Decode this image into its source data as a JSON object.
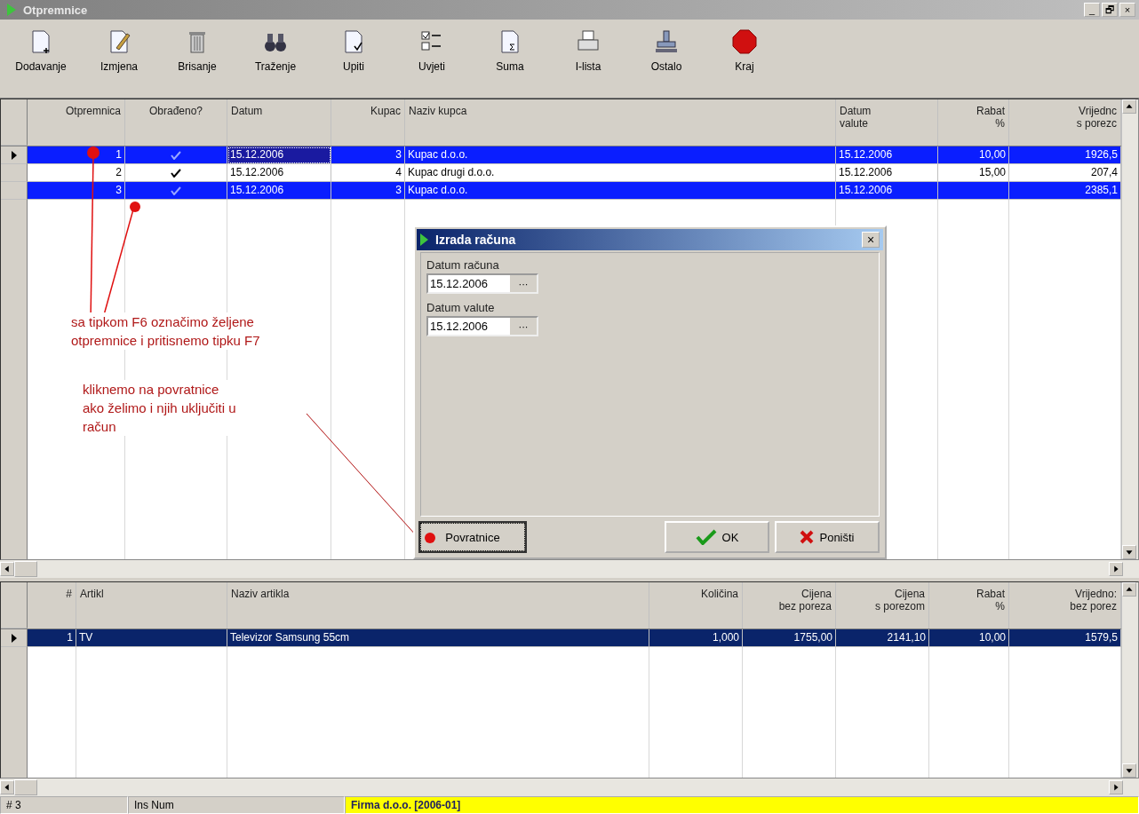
{
  "window": {
    "title": "Otpremnice",
    "controls": [
      "_",
      "🗗",
      "×"
    ]
  },
  "toolbar": [
    {
      "label": "Dodavanje",
      "kind": "new"
    },
    {
      "label": "Izmjena",
      "kind": "edit"
    },
    {
      "label": "Brisanje",
      "kind": "delete"
    },
    {
      "label": "Traženje",
      "kind": "find"
    },
    {
      "label": "Upiti",
      "kind": "query"
    },
    {
      "label": "Uvjeti",
      "kind": "conditions"
    },
    {
      "label": "Suma",
      "kind": "sum"
    },
    {
      "label": "I-lista",
      "kind": "print"
    },
    {
      "label": "Ostalo",
      "kind": "other"
    },
    {
      "label": "Kraj",
      "kind": "stop"
    }
  ],
  "upper_table": {
    "columns": [
      "Otpremnica",
      "Obrađeno?",
      "Datum",
      "Kupac",
      "Naziv kupca",
      "Datum\nvalute",
      "Rabat\n%",
      "Vrijednc\ns porezc"
    ],
    "rows": [
      {
        "selected": true,
        "current": true,
        "cells": [
          "1",
          "",
          "15.12.2006",
          "3",
          "Kupac d.o.o.",
          "15.12.2006",
          "10,00",
          "1926,5"
        ],
        "checked": true
      },
      {
        "selected": false,
        "current": false,
        "cells": [
          "2",
          "",
          "15.12.2006",
          "4",
          "Kupac drugi d.o.o.",
          "15.12.2006",
          "15,00",
          "207,4"
        ],
        "checked": true
      },
      {
        "selected": true,
        "current": false,
        "cells": [
          "3",
          "",
          "15.12.2006",
          "3",
          "Kupac d.o.o.",
          "15.12.2006",
          "",
          "2385,1"
        ],
        "checked": true
      }
    ]
  },
  "lower_table": {
    "columns": [
      "#",
      "Artikl",
      "Naziv artikla",
      "Količina",
      "Cijena\nbez poreza",
      "Cijena\ns porezom",
      "Rabat\n%",
      "Vrijedno:\nbez porez"
    ],
    "rows": [
      {
        "selected": true,
        "cells": [
          "1",
          "TV",
          "Televizor Samsung 55cm",
          "1,000",
          "1755,00",
          "2141,10",
          "10,00",
          "1579,5"
        ]
      }
    ]
  },
  "annotations": [
    "sa tipkom F6 označimo željene\notpremnice i pritisnemo tipku F7",
    "kliknemo na povratnice\nako želimo i njih uključiti u\nračun"
  ],
  "dialog": {
    "title": "Izrada računa",
    "close": "×",
    "fields": [
      {
        "label": "Datum računa",
        "value": "15.12.2006",
        "browse": "···"
      },
      {
        "label": "Datum valute",
        "value": "15.12.2006",
        "browse": "···"
      }
    ],
    "buttons": [
      {
        "label": "Povratnice",
        "kind": "plain"
      },
      {
        "label": "OK",
        "kind": "ok"
      },
      {
        "label": "Poništi",
        "kind": "cancel"
      }
    ]
  },
  "status_bar": {
    "record": "# 3",
    "keys": "Ins Num",
    "company": "Firma d.o.o. [2006-01]"
  }
}
